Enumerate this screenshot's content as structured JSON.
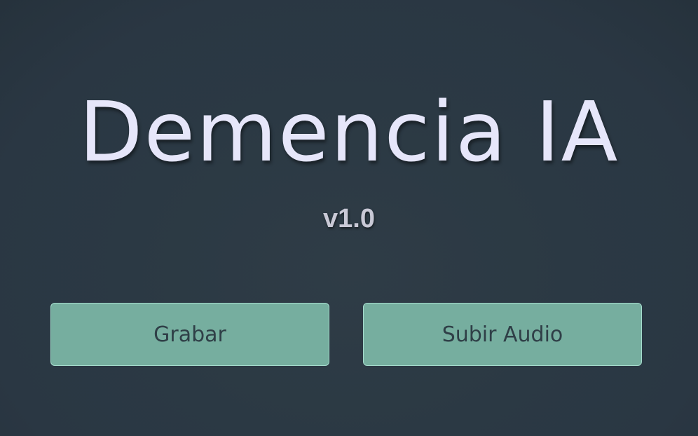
{
  "app": {
    "title": "Demencia IA",
    "version": "v1.0"
  },
  "actions": {
    "record_label": "Grabar",
    "upload_label": "Subir Audio"
  },
  "colors": {
    "background": "#2b3944",
    "title_text": "#e6e6fa",
    "version_text": "#c9c9d6",
    "button_fill": "#76ae9f",
    "button_border": "#a5dccd",
    "button_text": "#2f3f47"
  }
}
